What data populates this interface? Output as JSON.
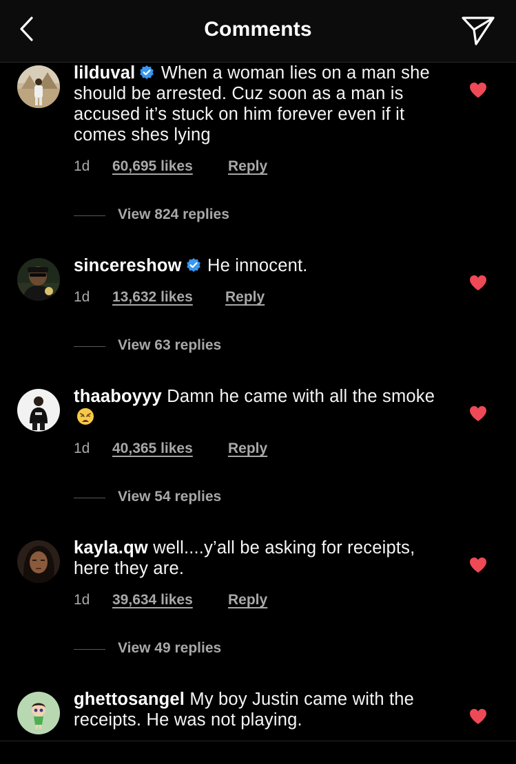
{
  "header": {
    "title": "Comments"
  },
  "colors": {
    "background": "#000000",
    "header_bg": "#0c0c0c",
    "heart": "#ed4956",
    "verified": "#3897f0",
    "secondary_text": "#a8a8a8"
  },
  "comments": [
    {
      "username": "lilduval",
      "verified": true,
      "text": "When a woman lies on a man she should be arrested. Cuz soon as a man is accused it’s stuck on him forever even if it comes shes lying",
      "time": "1d",
      "likes": "60,695 likes",
      "reply_label": "Reply",
      "view_replies": "View 824 replies",
      "liked": true
    },
    {
      "username": "sincereshow",
      "verified": true,
      "text": "He innocent.",
      "time": "1d",
      "likes": "13,632 likes",
      "reply_label": "Reply",
      "view_replies": "View 63 replies",
      "liked": true
    },
    {
      "username": "thaaboyyy",
      "verified": false,
      "text": "Damn he came with all the smoke",
      "emoji": "weary-face-emoji",
      "time": "1d",
      "likes": "40,365 likes",
      "reply_label": "Reply",
      "view_replies": "View 54 replies",
      "liked": true
    },
    {
      "username": "kayla.qw",
      "verified": false,
      "text": "well....y’all be asking for receipts, here they are.",
      "time": "1d",
      "likes": "39,634 likes",
      "reply_label": "Reply",
      "view_replies": "View 49 replies",
      "liked": true
    },
    {
      "username": "ghettosangel",
      "verified": false,
      "text": "My boy Justin came with the receipts. He was not playing.",
      "liked": true
    }
  ]
}
